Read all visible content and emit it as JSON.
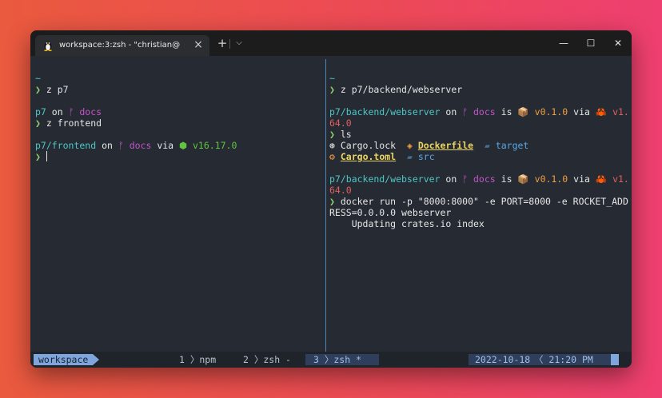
{
  "window": {
    "tab_title": "workspace:3:zsh - \"christian@",
    "tab_close": "×",
    "new_tab": "+",
    "tab_dropdown": "⌵",
    "minimize": "—",
    "maximize": "☐",
    "close": "✕"
  },
  "left_pane": {
    "l1": "~",
    "l2_prompt": "❯",
    "l2_cmd": " z p7",
    "l3_dir": "p7",
    "l3_on": " on ",
    "l3_branch": "ᚠ docs",
    "l4_prompt": "❯",
    "l4_cmd": " z frontend",
    "l5_dir": "p7/frontend",
    "l5_on": " on ",
    "l5_branch": "ᚠ docs",
    "l5_via": " via ",
    "l5_node": "⬢ v16.17.0",
    "l6_prompt": "❯"
  },
  "right_pane": {
    "r1": "~",
    "r2_prompt": "❯",
    "r2_cmd": " z p7/backend/webserver",
    "r3_dir": "p7/backend/webserver",
    "r3_on": " on ",
    "r3_branch": "ᚠ docs",
    "r3_is": " is ",
    "r3_pkg": "📦 v0.1.0",
    "r3_via": " via ",
    "r3_rust": "🦀 v1.",
    "r4": "64.0",
    "r5_prompt": "❯",
    "r5_cmd": " ls",
    "r6_f1": "⊛ Cargo.lock",
    "r6_f2": "Dockerfile",
    "r6_f3": "target",
    "r7_f1": "Cargo.toml",
    "r7_f2": "src",
    "r8_dir": "p7/backend/webserver",
    "r8_on": " on ",
    "r8_branch": "ᚠ docs",
    "r8_is": " is ",
    "r8_pkg": "📦 v0.1.0",
    "r8_via": " via ",
    "r8_rust": "🦀 v1.",
    "r9": "64.0",
    "r10_prompt": "❯",
    "r10_cmd": " docker run -p \"8000:8000\" -e PORT=8000 -e ROCKET_ADD",
    "r11": "RESS=0.0.0.0 webserver",
    "r12": "    Updating crates.io index"
  },
  "statusbar": {
    "session": "workspace",
    "w1": "1 〉npm",
    "w2": "2 〉zsh -",
    "w3": "3 〉zsh *",
    "date": "2022-10-18",
    "time": "〈 21:20 PM"
  }
}
